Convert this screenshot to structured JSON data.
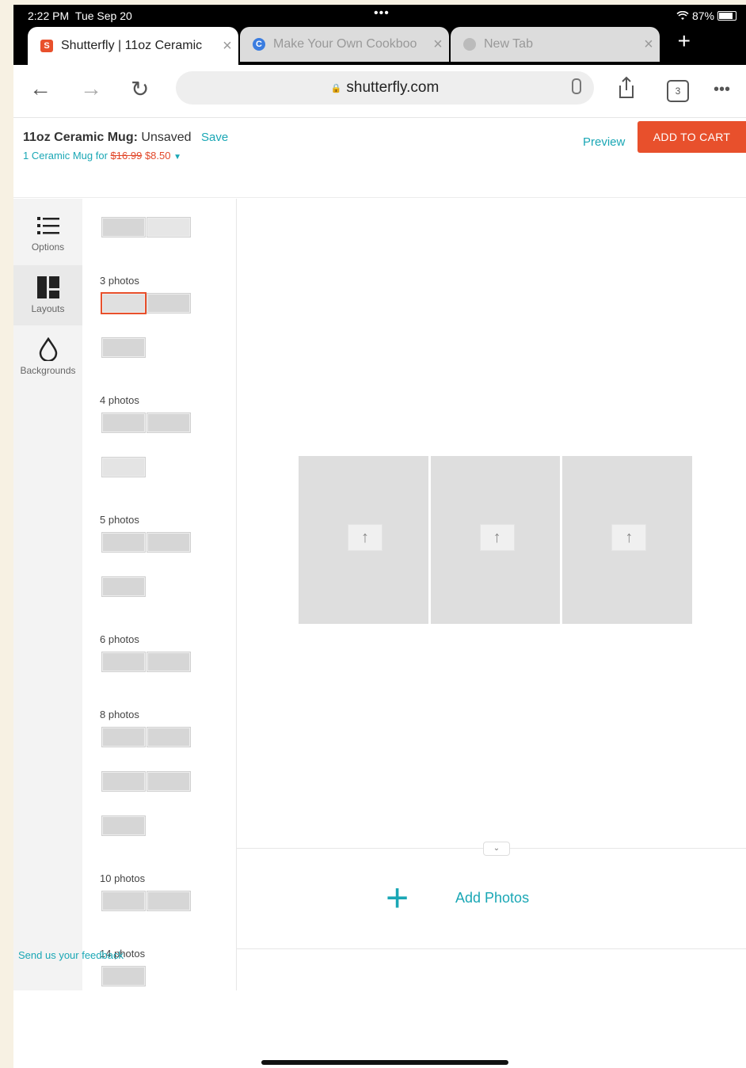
{
  "status": {
    "time": "2:22 PM",
    "date": "Tue Sep 20",
    "battery": "87%"
  },
  "tabs": [
    {
      "title": "Shutterfly | 11oz Ceramic",
      "favicon": "S",
      "color": "#e8502c",
      "active": true
    },
    {
      "title": "Make Your Own Cookboo",
      "favicon": "C",
      "color": "#3b7de0",
      "active": false
    },
    {
      "title": "New Tab",
      "favicon": "",
      "color": "#999999",
      "active": false
    }
  ],
  "toolbar": {
    "url": "shutterfly.com",
    "tab_count": "3"
  },
  "header": {
    "product": "11oz Ceramic Mug:",
    "state": "Unsaved",
    "save": "Save",
    "summary_prefix": "1 Ceramic Mug for",
    "old_price": "$16.99",
    "new_price": "$8.50",
    "preview": "Preview",
    "add_to_cart": "ADD TO CART"
  },
  "sidenav": {
    "items": [
      {
        "label": "Options",
        "icon": "list-icon"
      },
      {
        "label": "Layouts",
        "icon": "layout-icon"
      },
      {
        "label": "Backgrounds",
        "icon": "drop-icon"
      }
    ],
    "feedback": "Send us your feedback"
  },
  "layouts": {
    "groups": [
      "3 photos",
      "4 photos",
      "5 photos",
      "6 photos",
      "8 photos",
      "10 photos",
      "14 photos"
    ]
  },
  "canvas": {
    "add_photos": "Add Photos"
  },
  "colors": {
    "accent": "#1aa7b5",
    "cta": "#e8502c"
  }
}
